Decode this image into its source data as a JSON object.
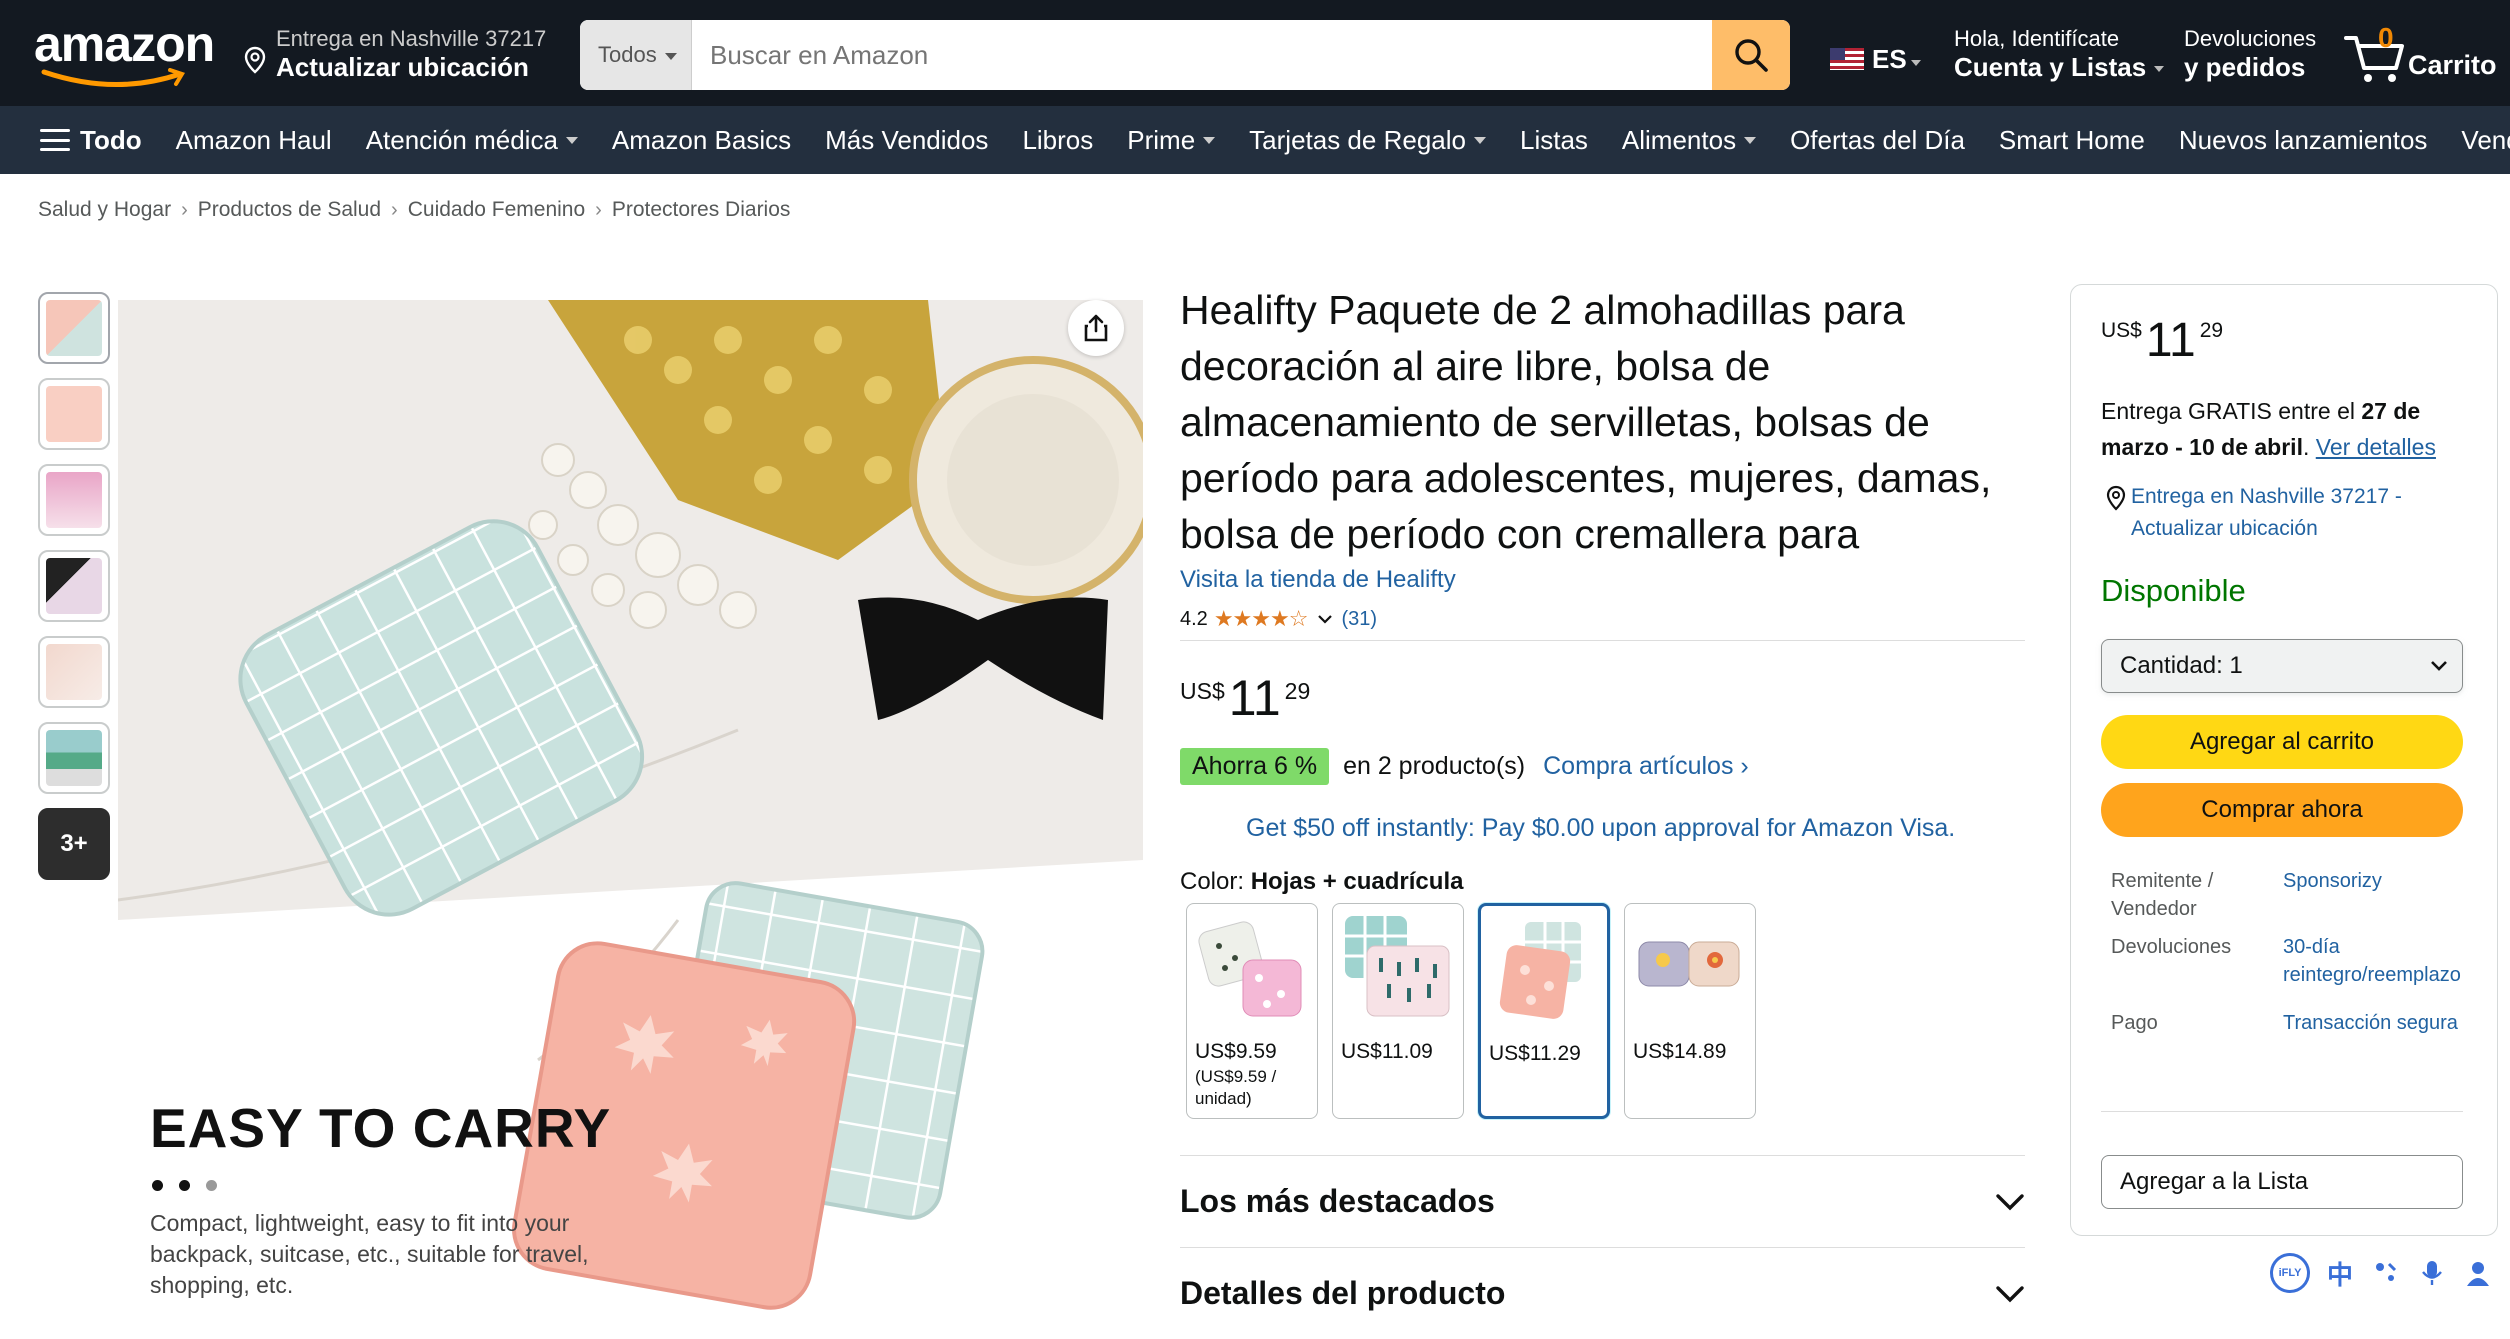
{
  "header": {
    "logo_text": "amazon",
    "deliver_line1": "Entrega en Nashville 37217",
    "deliver_line2": "Actualizar ubicación",
    "search_category": "Todos",
    "search_placeholder": "Buscar en Amazon",
    "language": "ES",
    "account_line1": "Hola, Identifícate",
    "account_line2": "Cuenta y Listas",
    "orders_line1": "Devoluciones",
    "orders_line2": "y pedidos",
    "cart_count": "0",
    "cart_label": "Carrito"
  },
  "nav": {
    "all": "Todo",
    "items": [
      {
        "label": "Amazon Haul",
        "dropdown": false
      },
      {
        "label": "Atención médica",
        "dropdown": true
      },
      {
        "label": "Amazon Basics",
        "dropdown": false
      },
      {
        "label": "Más Vendidos",
        "dropdown": false
      },
      {
        "label": "Libros",
        "dropdown": false
      },
      {
        "label": "Prime",
        "dropdown": true
      },
      {
        "label": "Tarjetas de Regalo",
        "dropdown": true
      },
      {
        "label": "Listas",
        "dropdown": false
      },
      {
        "label": "Alimentos",
        "dropdown": true
      },
      {
        "label": "Ofertas del Día",
        "dropdown": false
      },
      {
        "label": "Smart Home",
        "dropdown": false
      },
      {
        "label": "Nuevos lanzamientos",
        "dropdown": false
      },
      {
        "label": "Vender",
        "dropdown": false
      }
    ]
  },
  "breadcrumb": [
    "Salud y Hogar",
    "Productos de Salud",
    "Cuidado Femenino",
    "Protectores Diarios"
  ],
  "gallery": {
    "more_label": "3+",
    "image_heading": "EASY TO CARRY",
    "image_text": "Compact, lightweight, easy to fit into your backpack, suitcase, etc., suitable for travel, shopping, etc."
  },
  "product": {
    "title": "Healifty Paquete de 2 almohadillas para decoración al aire libre, bolsa de almacenamiento de servilletas, bolsas de período para adolescentes, mujeres, damas, bolsa de período con cremallera para",
    "store_link": "Visita la tienda de Healifty",
    "rating": "4.2",
    "stars": "★★★★☆",
    "rating_count": "(31)",
    "price_currency": "US$",
    "price_whole": "11",
    "price_fraction": "29",
    "save_badge": "Ahorra 6 %",
    "save_text": "en 2 producto(s)",
    "save_link": "Compra artículos ›",
    "promo": "Get $50 off instantly: Pay $0.00 upon approval for Amazon Visa.",
    "color_label": "Color:",
    "color_value": "Hojas + cuadrícula",
    "swatches": [
      {
        "price": "US$9.59",
        "unit": "(US$9.59 / unidad)"
      },
      {
        "price": "US$11.09",
        "unit": ""
      },
      {
        "price": "US$11.29",
        "unit": ""
      },
      {
        "price": "US$14.89",
        "unit": ""
      }
    ],
    "accordion": [
      "Los más destacados",
      "Detalles del producto"
    ]
  },
  "buybox": {
    "price_currency": "US$",
    "price_whole": "11",
    "price_fraction": "29",
    "delivery_prefix": "Entrega GRATIS entre el ",
    "delivery_dates": "27 de marzo - 10 de abril",
    "delivery_link": "Ver detalles",
    "location": "Entrega en Nashville 37217 - Actualizar ubicación",
    "availability": "Disponible",
    "quantity": "Cantidad:  1",
    "add_to_cart": "Agregar al carrito",
    "buy_now": "Comprar ahora",
    "seller_key": "Remitente / Vendedor",
    "seller_val": "Sponsorizy",
    "returns_key": "Devoluciones",
    "returns_val": "30-día reintegro/reemplazo",
    "payment_key": "Pago",
    "payment_val": "Transacción segura",
    "add_to_list": "Agregar a la Lista"
  },
  "tray": {
    "ifly": "iFLY",
    "zh": "中"
  },
  "colors": {
    "header_bg": "#131921",
    "nav_bg": "#232f3e",
    "link": "#2162a1",
    "cart_button": "#ffd814",
    "buy_button": "#ffa41c",
    "available": "#007600",
    "save_badge": "#7fda69"
  }
}
